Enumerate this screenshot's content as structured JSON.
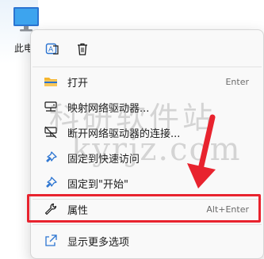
{
  "desktop": {
    "icon_name": "computer-icon",
    "label": "此电"
  },
  "context_menu": {
    "top_actions": [
      {
        "name": "translate-icon"
      },
      {
        "name": "trash-icon"
      }
    ],
    "items": [
      {
        "label": "打开",
        "accelerator": "Enter",
        "icon": "folder-icon"
      },
      {
        "label": "映射网络驱动器...",
        "accelerator": "",
        "icon": "network-drive-icon"
      },
      {
        "label": "断开网络驱动器的连接...",
        "accelerator": "",
        "icon": "disconnect-drive-icon"
      },
      {
        "label": "固定到快速访问",
        "accelerator": "",
        "icon": "pin-icon"
      },
      {
        "label": "固定到\"开始\"",
        "accelerator": "",
        "icon": "pin-icon"
      },
      {
        "label": "属性",
        "accelerator": "Alt+Enter",
        "icon": "wrench-icon"
      },
      {
        "label": "显示更多选项",
        "accelerator": "",
        "icon": "share-icon"
      }
    ]
  },
  "watermark": {
    "line1": "科研软件站",
    "line2": "kyrjz.com"
  },
  "colors": {
    "highlight": "#e8232e",
    "folder": "#f5b52e",
    "accent": "#2b74d1"
  }
}
